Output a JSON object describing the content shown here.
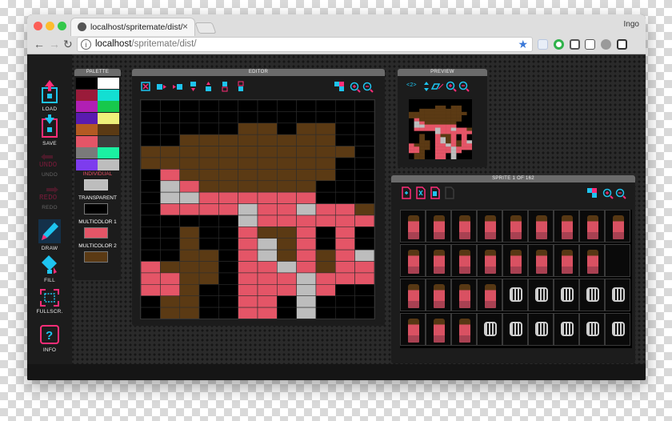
{
  "browser": {
    "tab_title": "localhost/spritemate/dist/",
    "tab_close": "×",
    "user": "Ingo",
    "url_host": "localhost",
    "url_path": "/spritemate/dist/",
    "traffic_colors": [
      "#fc5f57",
      "#fdbc2e",
      "#34c84a"
    ]
  },
  "toolbar": {
    "load": "LOAD",
    "save": "SAVE",
    "undo": "UNDO",
    "redo": "REDO",
    "draw": "DRAW",
    "fill": "FILL",
    "fullscreen": "FULLSCR.",
    "info": "INFO"
  },
  "palette": {
    "title": "PALETTE",
    "colors": [
      "#000000",
      "#ffffff",
      "#9a1b3a",
      "#13dfd2",
      "#b11fb4",
      "#17c84c",
      "#5a1bb0",
      "#eef07a",
      "#b45a22",
      "#5b3a14",
      "#e45567",
      "#3d3d3d",
      "#7a7a7a",
      "#1bf0a2",
      "#7d3cee",
      "#bdbdbd"
    ],
    "individual": "INDIVIDUAL",
    "individual_color": "#bdbdbd",
    "transparent": "TRANSPARENT",
    "transparent_color": "#000000",
    "multicolor1": "MULTICOLOR 1",
    "multicolor1_color": "#e45567",
    "multicolor2": "MULTICOLOR 2",
    "multicolor2_color": "#5b3a14"
  },
  "editor": {
    "title": "EDITOR",
    "pixels": [
      "............",
      "............",
      ".....AA.AA..",
      "..AAAAAAAA..",
      "AAAAAAAAAAA.",
      "AAAAAAAAAA..",
      ".RAAAAAAAA..",
      ".GRAAAAAA...",
      ".GGRRRRRR...",
      ".RRRRGRRGRRA",
      ".....GRRRRRR",
      "..A..RAAR.R.",
      "..A..RGAR.R.",
      "..AA.RGARARG",
      "RAAA.RRGRARR",
      "RRAA.RRRGRRR",
      "RRA..RRRGR..",
      ".AA..RR.G...",
      ".AA..RR.G..."
    ],
    "colors": {
      "A": "#5b3a14",
      "R": "#e45567",
      "G": "#bdbdbd",
      ".": "#000000"
    }
  },
  "preview": {
    "title": "PREVIEW",
    "zoom_label": "<2>"
  },
  "sprites": {
    "title": "SPRITE 1 OF 162"
  }
}
